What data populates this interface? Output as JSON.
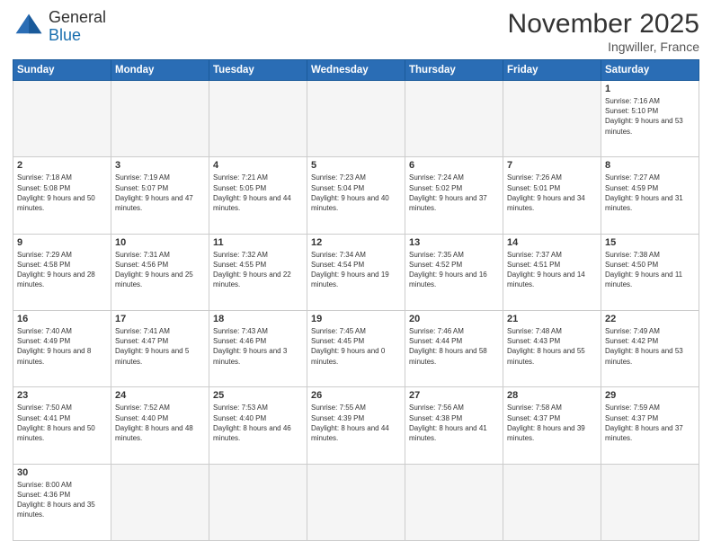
{
  "logo": {
    "line1": "General",
    "line2": "Blue"
  },
  "header": {
    "month_year": "November 2025",
    "location": "Ingwiller, France"
  },
  "weekdays": [
    "Sunday",
    "Monday",
    "Tuesday",
    "Wednesday",
    "Thursday",
    "Friday",
    "Saturday"
  ],
  "weeks": [
    [
      {
        "day": "",
        "empty": true
      },
      {
        "day": "",
        "empty": true
      },
      {
        "day": "",
        "empty": true
      },
      {
        "day": "",
        "empty": true
      },
      {
        "day": "",
        "empty": true
      },
      {
        "day": "",
        "empty": true
      },
      {
        "day": "1",
        "sunrise": "7:16 AM",
        "sunset": "5:10 PM",
        "daylight": "9 hours and 53 minutes."
      }
    ],
    [
      {
        "day": "2",
        "sunrise": "7:18 AM",
        "sunset": "5:08 PM",
        "daylight": "9 hours and 50 minutes."
      },
      {
        "day": "3",
        "sunrise": "7:19 AM",
        "sunset": "5:07 PM",
        "daylight": "9 hours and 47 minutes."
      },
      {
        "day": "4",
        "sunrise": "7:21 AM",
        "sunset": "5:05 PM",
        "daylight": "9 hours and 44 minutes."
      },
      {
        "day": "5",
        "sunrise": "7:23 AM",
        "sunset": "5:04 PM",
        "daylight": "9 hours and 40 minutes."
      },
      {
        "day": "6",
        "sunrise": "7:24 AM",
        "sunset": "5:02 PM",
        "daylight": "9 hours and 37 minutes."
      },
      {
        "day": "7",
        "sunrise": "7:26 AM",
        "sunset": "5:01 PM",
        "daylight": "9 hours and 34 minutes."
      },
      {
        "day": "8",
        "sunrise": "7:27 AM",
        "sunset": "4:59 PM",
        "daylight": "9 hours and 31 minutes."
      }
    ],
    [
      {
        "day": "9",
        "sunrise": "7:29 AM",
        "sunset": "4:58 PM",
        "daylight": "9 hours and 28 minutes."
      },
      {
        "day": "10",
        "sunrise": "7:31 AM",
        "sunset": "4:56 PM",
        "daylight": "9 hours and 25 minutes."
      },
      {
        "day": "11",
        "sunrise": "7:32 AM",
        "sunset": "4:55 PM",
        "daylight": "9 hours and 22 minutes."
      },
      {
        "day": "12",
        "sunrise": "7:34 AM",
        "sunset": "4:54 PM",
        "daylight": "9 hours and 19 minutes."
      },
      {
        "day": "13",
        "sunrise": "7:35 AM",
        "sunset": "4:52 PM",
        "daylight": "9 hours and 16 minutes."
      },
      {
        "day": "14",
        "sunrise": "7:37 AM",
        "sunset": "4:51 PM",
        "daylight": "9 hours and 14 minutes."
      },
      {
        "day": "15",
        "sunrise": "7:38 AM",
        "sunset": "4:50 PM",
        "daylight": "9 hours and 11 minutes."
      }
    ],
    [
      {
        "day": "16",
        "sunrise": "7:40 AM",
        "sunset": "4:49 PM",
        "daylight": "9 hours and 8 minutes."
      },
      {
        "day": "17",
        "sunrise": "7:41 AM",
        "sunset": "4:47 PM",
        "daylight": "9 hours and 5 minutes."
      },
      {
        "day": "18",
        "sunrise": "7:43 AM",
        "sunset": "4:46 PM",
        "daylight": "9 hours and 3 minutes."
      },
      {
        "day": "19",
        "sunrise": "7:45 AM",
        "sunset": "4:45 PM",
        "daylight": "9 hours and 0 minutes."
      },
      {
        "day": "20",
        "sunrise": "7:46 AM",
        "sunset": "4:44 PM",
        "daylight": "8 hours and 58 minutes."
      },
      {
        "day": "21",
        "sunrise": "7:48 AM",
        "sunset": "4:43 PM",
        "daylight": "8 hours and 55 minutes."
      },
      {
        "day": "22",
        "sunrise": "7:49 AM",
        "sunset": "4:42 PM",
        "daylight": "8 hours and 53 minutes."
      }
    ],
    [
      {
        "day": "23",
        "sunrise": "7:50 AM",
        "sunset": "4:41 PM",
        "daylight": "8 hours and 50 minutes."
      },
      {
        "day": "24",
        "sunrise": "7:52 AM",
        "sunset": "4:40 PM",
        "daylight": "8 hours and 48 minutes."
      },
      {
        "day": "25",
        "sunrise": "7:53 AM",
        "sunset": "4:40 PM",
        "daylight": "8 hours and 46 minutes."
      },
      {
        "day": "26",
        "sunrise": "7:55 AM",
        "sunset": "4:39 PM",
        "daylight": "8 hours and 44 minutes."
      },
      {
        "day": "27",
        "sunrise": "7:56 AM",
        "sunset": "4:38 PM",
        "daylight": "8 hours and 41 minutes."
      },
      {
        "day": "28",
        "sunrise": "7:58 AM",
        "sunset": "4:37 PM",
        "daylight": "8 hours and 39 minutes."
      },
      {
        "day": "29",
        "sunrise": "7:59 AM",
        "sunset": "4:37 PM",
        "daylight": "8 hours and 37 minutes."
      }
    ],
    [
      {
        "day": "30",
        "sunrise": "8:00 AM",
        "sunset": "4:36 PM",
        "daylight": "8 hours and 35 minutes."
      },
      {
        "day": "",
        "empty": true
      },
      {
        "day": "",
        "empty": true
      },
      {
        "day": "",
        "empty": true
      },
      {
        "day": "",
        "empty": true
      },
      {
        "day": "",
        "empty": true
      },
      {
        "day": "",
        "empty": true
      }
    ]
  ]
}
